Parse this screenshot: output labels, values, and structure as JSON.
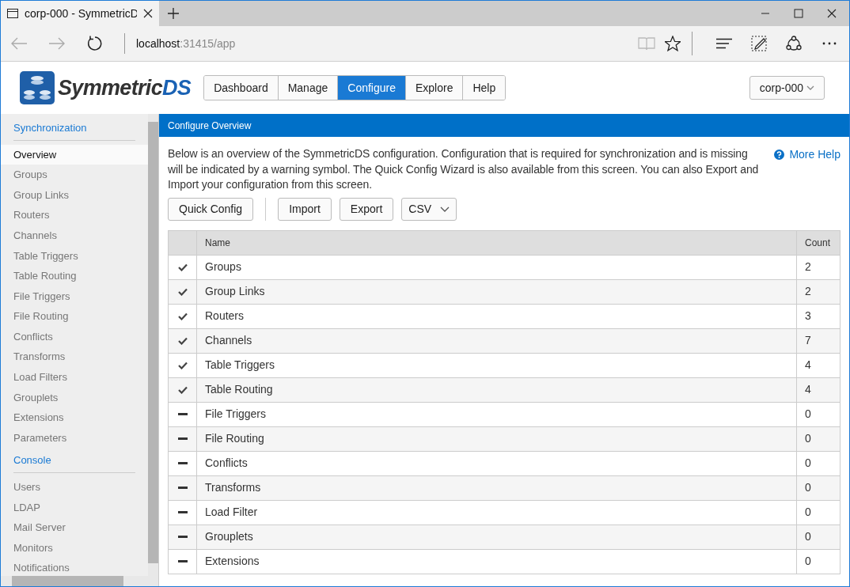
{
  "browser": {
    "tab_title": "corp-000 - SymmetricD",
    "address_host": "localhost",
    "address_rest": ":31415/app"
  },
  "logo": {
    "main": "Symmetric",
    "accent": "DS"
  },
  "nav": [
    {
      "label": "Dashboard",
      "selected": false
    },
    {
      "label": "Manage",
      "selected": false
    },
    {
      "label": "Configure",
      "selected": true
    },
    {
      "label": "Explore",
      "selected": false
    },
    {
      "label": "Help",
      "selected": false
    }
  ],
  "node_menu": "corp-000",
  "sidebar": {
    "sections": [
      {
        "title": "Synchronization",
        "items": [
          {
            "label": "Overview",
            "selected": true
          },
          {
            "label": "Groups",
            "selected": false
          },
          {
            "label": "Group Links",
            "selected": false
          },
          {
            "label": "Routers",
            "selected": false
          },
          {
            "label": "Channels",
            "selected": false
          },
          {
            "label": "Table Triggers",
            "selected": false
          },
          {
            "label": "Table Routing",
            "selected": false
          },
          {
            "label": "File Triggers",
            "selected": false
          },
          {
            "label": "File Routing",
            "selected": false
          },
          {
            "label": "Conflicts",
            "selected": false
          },
          {
            "label": "Transforms",
            "selected": false
          },
          {
            "label": "Load Filters",
            "selected": false
          },
          {
            "label": "Grouplets",
            "selected": false
          },
          {
            "label": "Extensions",
            "selected": false
          },
          {
            "label": "Parameters",
            "selected": false
          }
        ]
      },
      {
        "title": "Console",
        "items": [
          {
            "label": "Users",
            "selected": false
          },
          {
            "label": "LDAP",
            "selected": false
          },
          {
            "label": "Mail Server",
            "selected": false
          },
          {
            "label": "Monitors",
            "selected": false
          },
          {
            "label": "Notifications",
            "selected": false
          }
        ]
      }
    ]
  },
  "panel": {
    "title": "Configure Overview",
    "description": "Below is an overview of the SymmetricDS configuration. Configuration that is required for synchronization and is missing will be indicated by a warning symbol. The Quick Config Wizard is also available from this screen. You can also Export and Import your configuration from this screen.",
    "help_link": "More Help",
    "buttons": [
      "Quick Config",
      "Import",
      "Export"
    ],
    "format": "CSV"
  },
  "table": {
    "columns": [
      "Name",
      "Count"
    ],
    "rows": [
      {
        "configured": true,
        "name": "Groups",
        "count": "2"
      },
      {
        "configured": true,
        "name": "Group Links",
        "count": "2"
      },
      {
        "configured": true,
        "name": "Routers",
        "count": "3"
      },
      {
        "configured": true,
        "name": "Channels",
        "count": "7"
      },
      {
        "configured": true,
        "name": "Table Triggers",
        "count": "4"
      },
      {
        "configured": true,
        "name": "Table Routing",
        "count": "4"
      },
      {
        "configured": false,
        "name": "File Triggers",
        "count": "0"
      },
      {
        "configured": false,
        "name": "File Routing",
        "count": "0"
      },
      {
        "configured": false,
        "name": "Conflicts",
        "count": "0"
      },
      {
        "configured": false,
        "name": "Transforms",
        "count": "0"
      },
      {
        "configured": false,
        "name": "Load Filter",
        "count": "0"
      },
      {
        "configured": false,
        "name": "Grouplets",
        "count": "0"
      },
      {
        "configured": false,
        "name": "Extensions",
        "count": "0"
      }
    ]
  }
}
